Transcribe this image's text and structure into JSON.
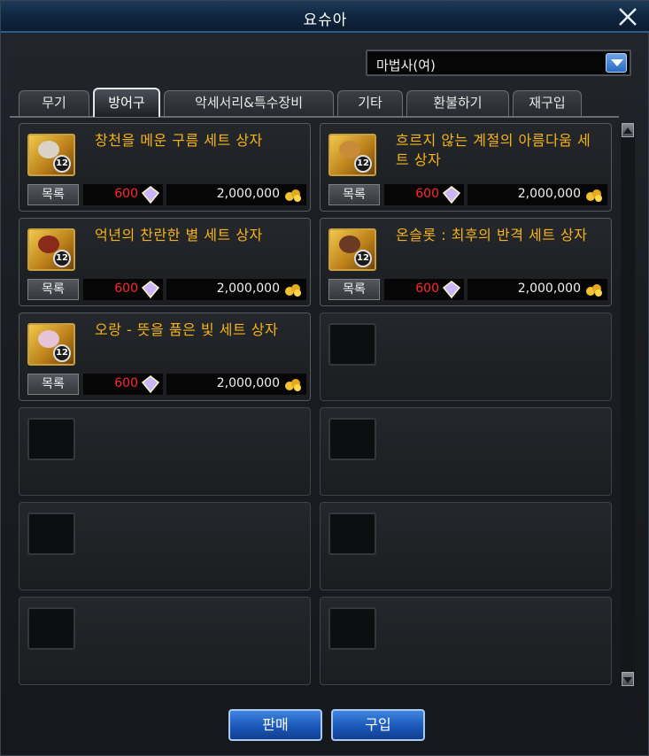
{
  "window": {
    "title": "요슈아"
  },
  "class_select": {
    "value": "마법사(여)"
  },
  "tabs": [
    {
      "label": "무기"
    },
    {
      "label": "방어구",
      "active": true
    },
    {
      "label": "악세서리&특수장비"
    },
    {
      "label": "기타"
    },
    {
      "label": "환불하기"
    },
    {
      "label": "재구입"
    }
  ],
  "items": [
    {
      "name": "창천을 메운 구름 세트 상자",
      "list_label": "목록",
      "cost": "600",
      "price": "2,000,000",
      "level": "12",
      "emblem_color": "#d9d2c5"
    },
    {
      "name": "흐르지 않는 계절의 아름다움 세트 상자",
      "list_label": "목록",
      "cost": "600",
      "price": "2,000,000",
      "level": "12",
      "emblem_color": "#c98a3a"
    },
    {
      "name": "억년의 찬란한 별 세트 상자",
      "list_label": "목록",
      "cost": "600",
      "price": "2,000,000",
      "level": "12",
      "emblem_color": "#8a2a1a"
    },
    {
      "name": "온슬롯 : 최후의 반격 세트 상자",
      "list_label": "목록",
      "cost": "600",
      "price": "2,000,000",
      "level": "12",
      "emblem_color": "#6a3a22"
    },
    {
      "name": "오랑 - 뜻을 품은 빛 세트 상자",
      "list_label": "목록",
      "cost": "600",
      "price": "2,000,000",
      "level": "12",
      "emblem_color": "#e6c3d6"
    }
  ],
  "buttons": {
    "sell": "판매",
    "buy": "구입"
  },
  "colors": {
    "item_name": "#f5b31c",
    "cost": "#ff2a2a",
    "accent": "#2b68c2"
  }
}
